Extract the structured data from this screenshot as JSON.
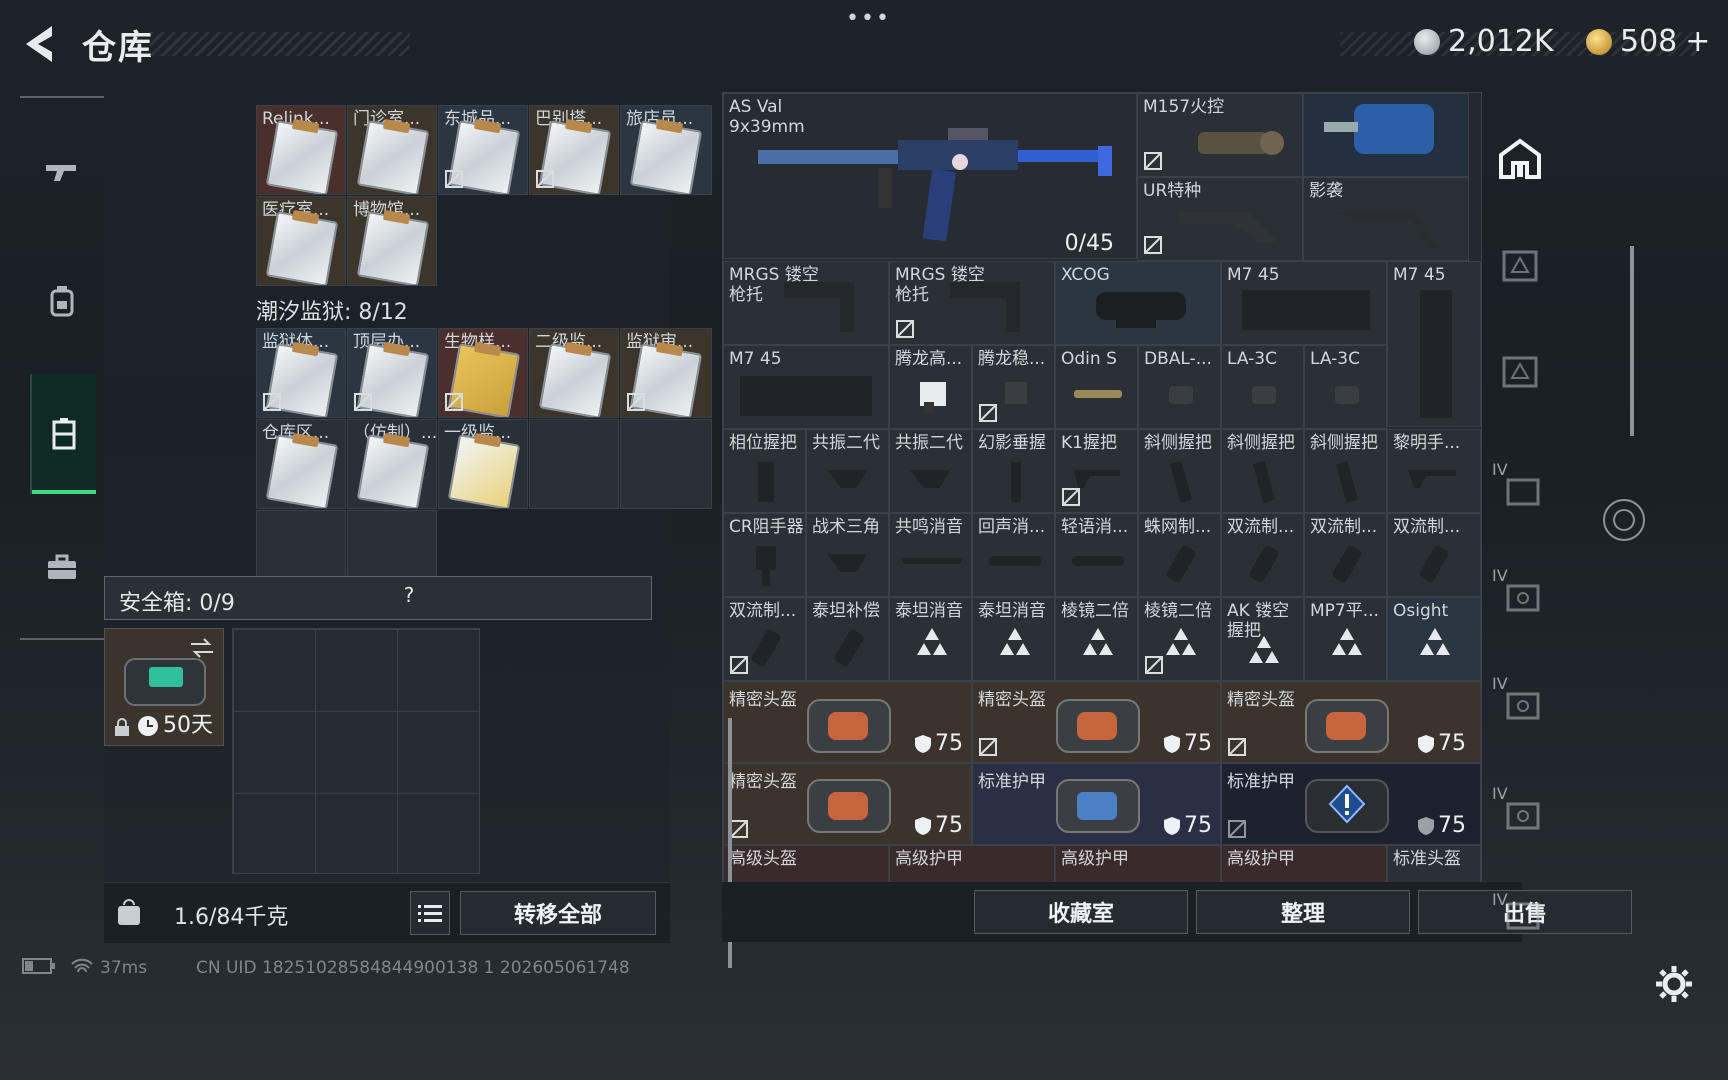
{
  "header": {
    "title": "仓库",
    "menu_dots": "•••"
  },
  "currency": [
    {
      "value": "2,012K",
      "icon": "silver-coin-icon",
      "color": "#b8bec4"
    },
    {
      "value": "508",
      "plus": "+",
      "icon": "gold-coin-icon",
      "color": "#d9a63a"
    }
  ],
  "nav": [
    "gun-icon",
    "backpack-icon",
    "locker-icon",
    "briefcase-icon"
  ],
  "left": {
    "cards_top": [
      "Relink...",
      "门诊室...",
      "东城品...",
      "巴别塔...",
      "旅店员...",
      "医疗室...",
      "博物馆..."
    ],
    "section2_title": "潮汐监狱: 8/12",
    "cards_mid": [
      "监狱体...",
      "顶层办...",
      "生物样...",
      "二级监...",
      "监狱审...",
      "仓库区...",
      "（仿制）...",
      "一级监..."
    ],
    "safe_title": "安全箱: 0/9",
    "safe_help": "?",
    "safe_timer": "50天",
    "weight": "1.6/84千克",
    "transfer_all": "转移全部"
  },
  "right": {
    "weapon": {
      "name": "AS Val",
      "caliber": "9x39mm",
      "ammo": "0/45"
    },
    "row1": [
      "M157火控",
      "UR特种",
      "影袭"
    ],
    "row2": [
      "MRGS 镂空枪托",
      "MRGS 镂空枪托",
      "XCOG",
      "M7 45",
      "M7 45"
    ],
    "row3": [
      "M7 45",
      "腾龙高...",
      "腾龙稳...",
      "Odin S",
      "DBAL-...",
      "LA-3C",
      "LA-3C"
    ],
    "row4": [
      "相位握把",
      "共振二代",
      "共振二代",
      "幻影垂握",
      "K1握把",
      "斜侧握把",
      "斜侧握把",
      "斜侧握把",
      "黎明手..."
    ],
    "row5": [
      "CR阻手器",
      "战术三角",
      "共鸣消音",
      "回声消...",
      "轻语消...",
      "蛛网制...",
      "双流制...",
      "双流制...",
      "双流制..."
    ],
    "row6": [
      "双流制...",
      "泰坦补偿",
      "泰坦消音",
      "泰坦消音",
      "棱镜二倍",
      "棱镜二倍",
      "AK 镂空握把",
      "MP7平...",
      "Osight"
    ],
    "armor": [
      {
        "label": "精密头盔",
        "value": "75"
      },
      {
        "label": "精密头盔",
        "value": "75"
      },
      {
        "label": "精密头盔",
        "value": "75"
      },
      {
        "label": "精密头盔",
        "value": "75"
      },
      {
        "label": "标准护甲",
        "value": "75"
      },
      {
        "label": "标准护甲",
        "value": "75"
      }
    ],
    "bottom_row": [
      "高级头盔",
      "高级护甲",
      "高级护甲",
      "高级护甲",
      "标准头盔"
    ],
    "buttons": {
      "collection": "收藏室",
      "sort": "整理",
      "sell": "出售"
    },
    "tabs_roman": [
      "IV",
      "IV",
      "IV",
      "IV",
      "IV"
    ]
  },
  "status": {
    "ping": "37ms",
    "uid": "CN UID 18251028584844900138 1 202605061748"
  }
}
